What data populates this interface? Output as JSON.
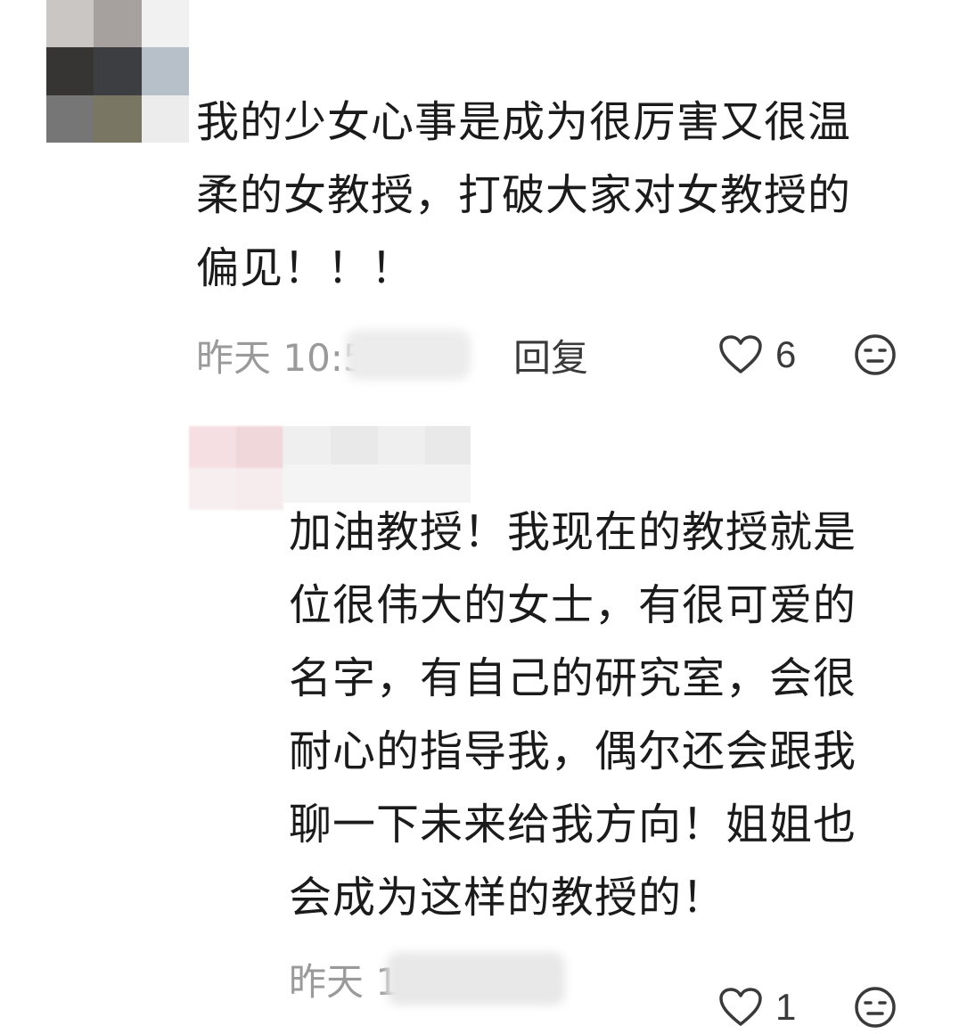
{
  "comments": [
    {
      "text": "我的少女心事是成为很厉害又很温\n柔的女教授，打破大家对女教授的\n偏见！！！",
      "time_prefix": "昨天 10:5",
      "reply_label": "回复",
      "like_count": "6"
    },
    {
      "text": "加油教授！我现在的教授就是\n位很伟大的女士，有很可爱的\n名字，有自己的研究室，会很\n耐心的指导我，偶尔还会跟我\n聊一下未来给我方向！姐姐也\n会成为这样的教授的！",
      "time_prefix": "昨天 1",
      "like_count": "1"
    }
  ],
  "icons": {
    "like": "heart-outline-icon",
    "reaction": "neutral-face-icon"
  },
  "colors": {
    "text": "#1b1b1b",
    "meta": "#9a9a9a",
    "action": "#3a3a3a"
  }
}
